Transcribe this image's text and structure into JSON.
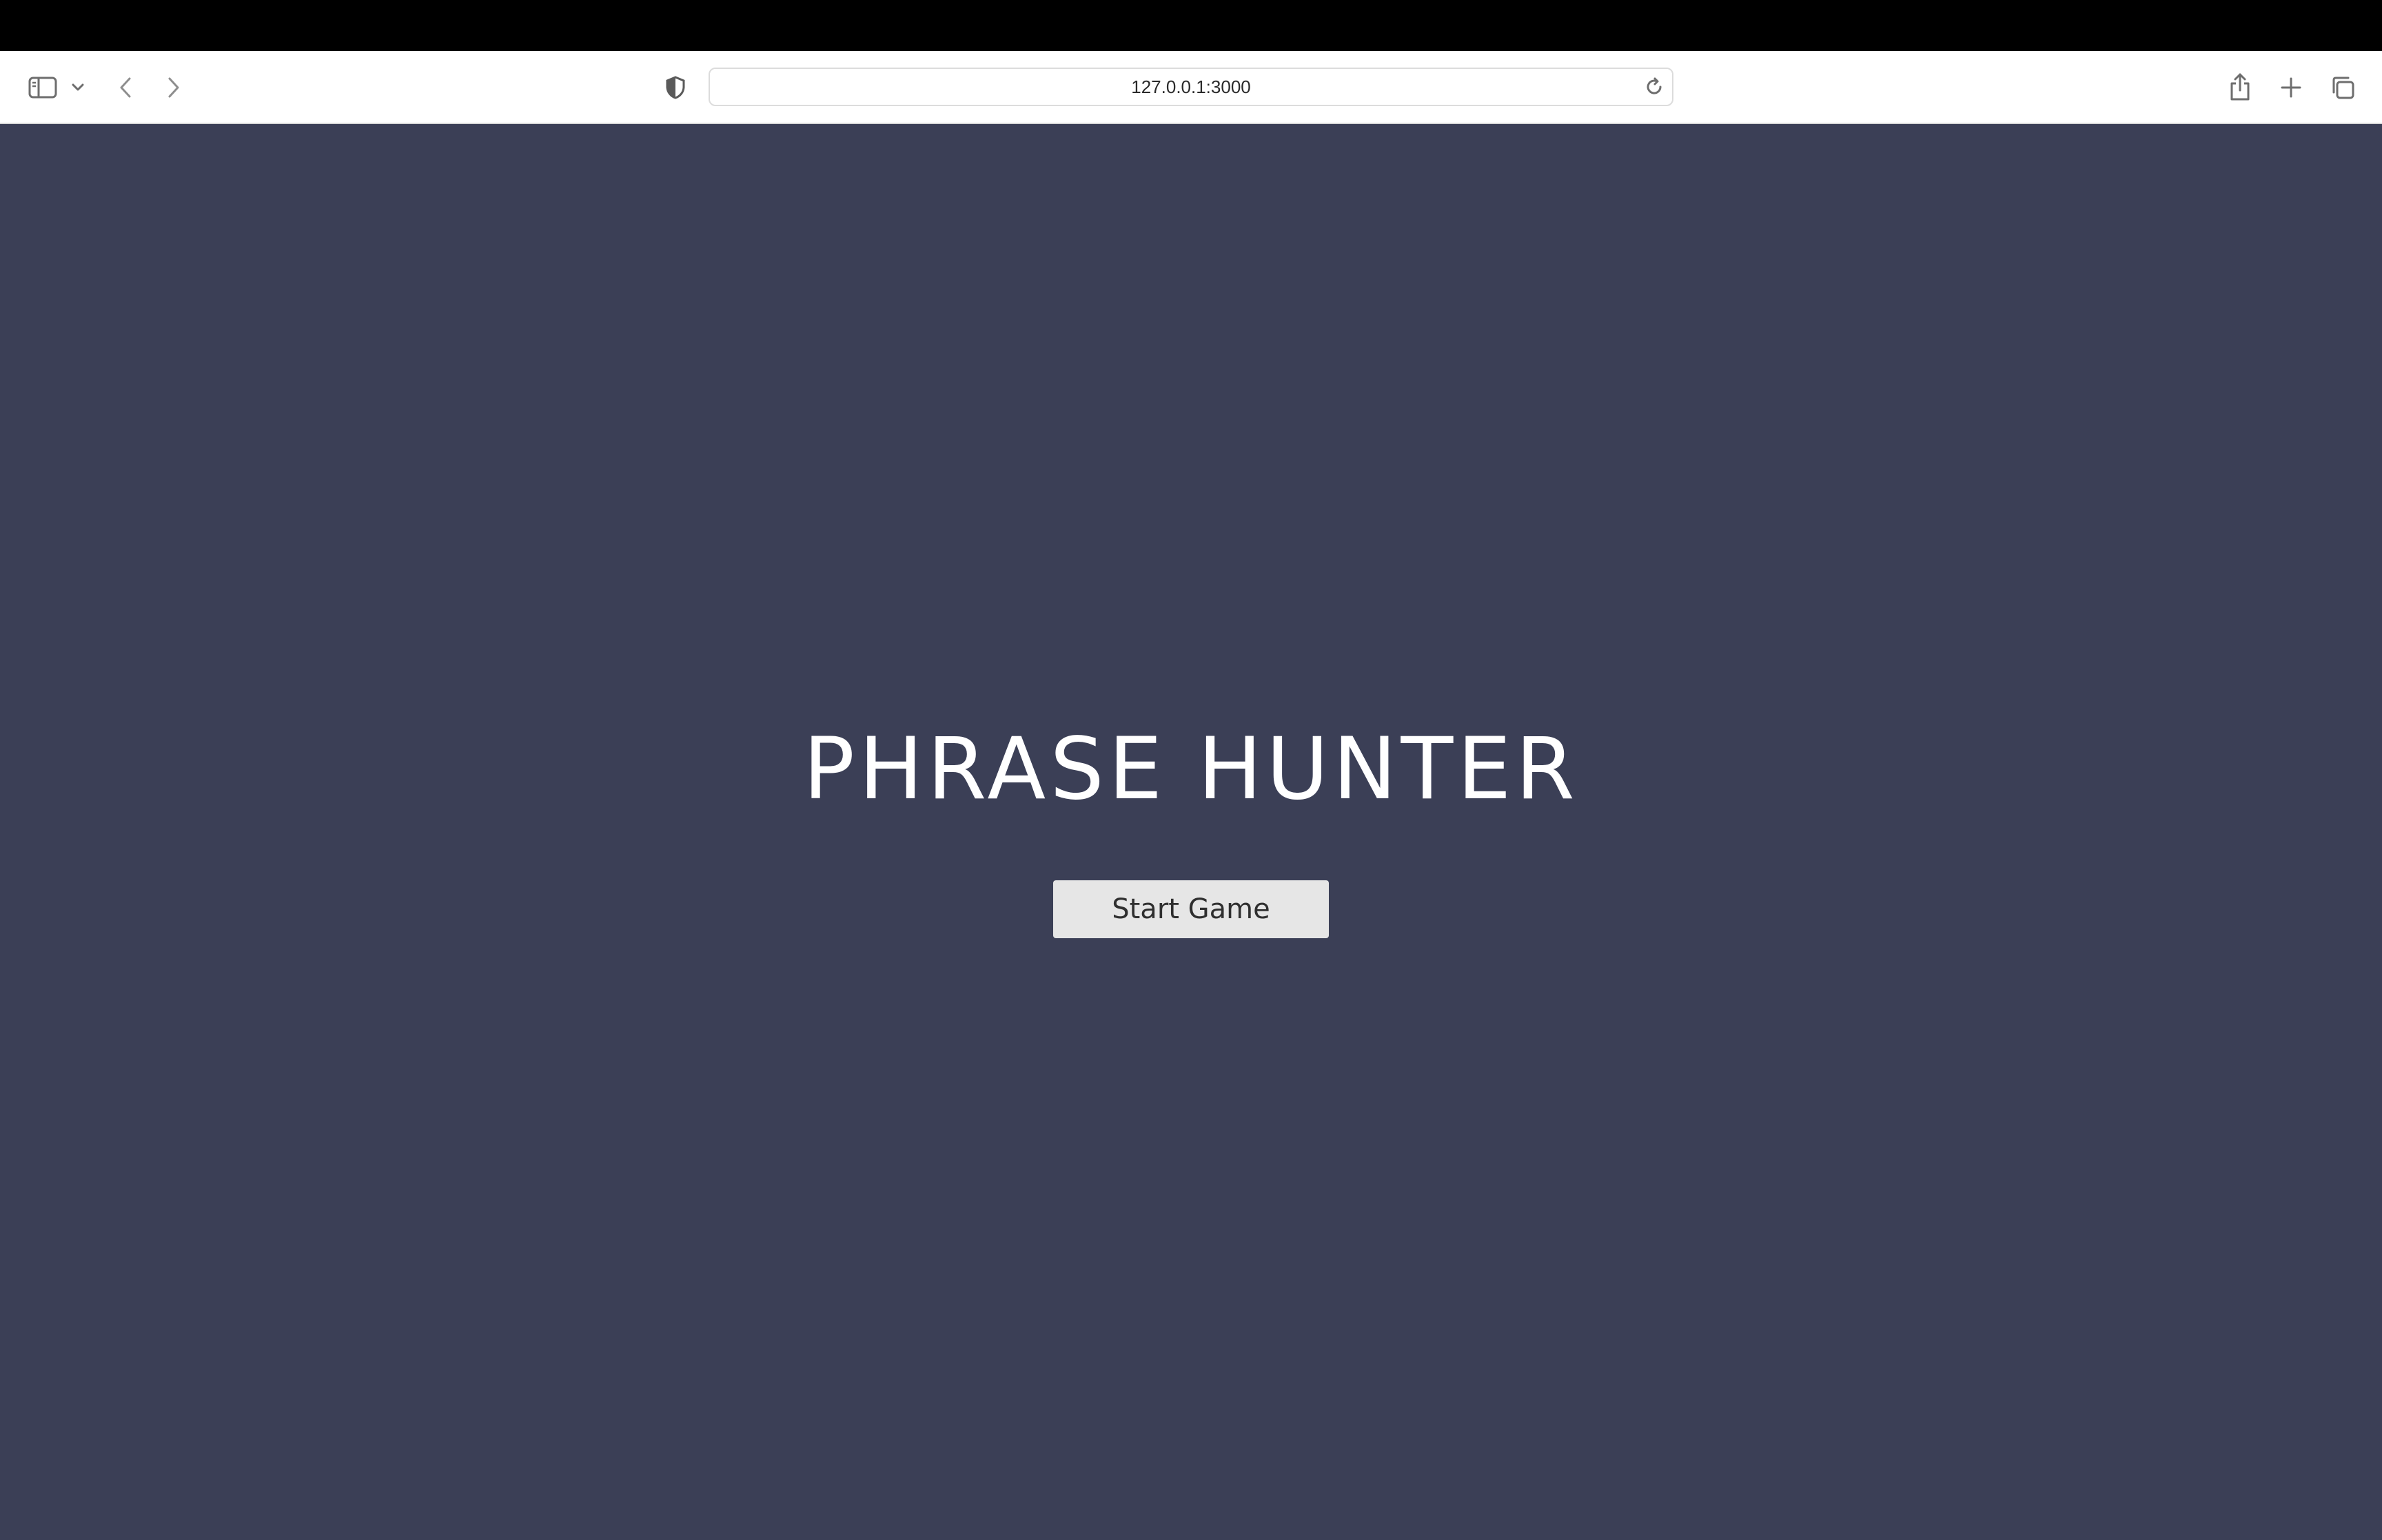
{
  "browser": {
    "url": "127.0.0.1:3000",
    "icons": {
      "sidebar": "sidebar-toggle-icon",
      "sidebar_menu": "chevron-down-icon",
      "back": "chevron-left-icon",
      "forward": "chevron-right-icon",
      "privacy": "shield-icon",
      "reload": "reload-icon",
      "share": "share-icon",
      "new_tab": "plus-icon",
      "tabs": "tab-overview-icon"
    }
  },
  "page": {
    "title": "PHRASE HUNTER",
    "start_button_label": "Start Game",
    "background_color": "#3b3f56",
    "button_color": "#e6e6e6"
  }
}
